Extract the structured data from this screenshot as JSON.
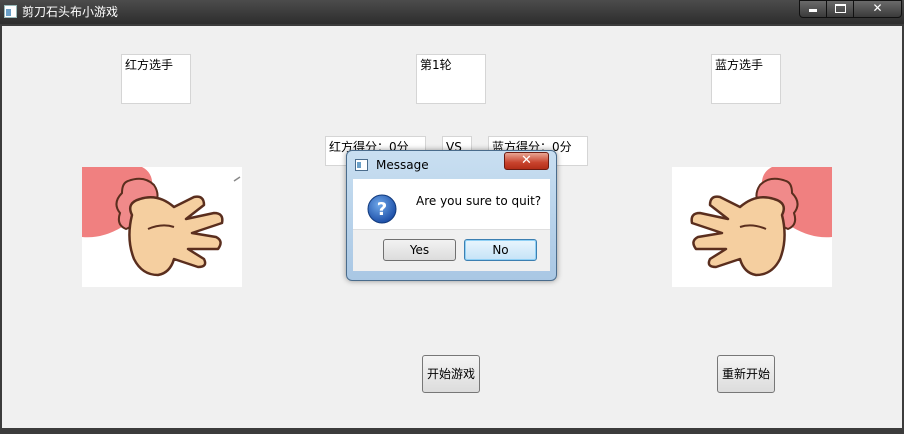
{
  "window": {
    "title": "剪刀石头布小游戏",
    "controls": {
      "minimize": "minimize",
      "maximize": "maximize",
      "close": "✕"
    }
  },
  "game": {
    "red_player_label": "红方选手",
    "round_label": "第1轮",
    "blue_player_label": "蓝方选手",
    "red_score": "红方得分：0分",
    "vs": "VS",
    "blue_score": "蓝方得分：0分",
    "start_button": "开始游戏",
    "restart_button": "重新开始"
  },
  "dialog": {
    "title": "Message",
    "message": "Are you sure to quit?",
    "close_glyph": "✕",
    "yes_label": "Yes",
    "no_label": "No",
    "icon": "question-icon"
  },
  "colors": {
    "client_bg": "#f0f0f0",
    "titlebar": "#2d2d2d",
    "sleeve": "#f08080",
    "skin": "#f5cfa0",
    "outline": "#5a2e1e",
    "question_blue": "#1d4fa8"
  }
}
